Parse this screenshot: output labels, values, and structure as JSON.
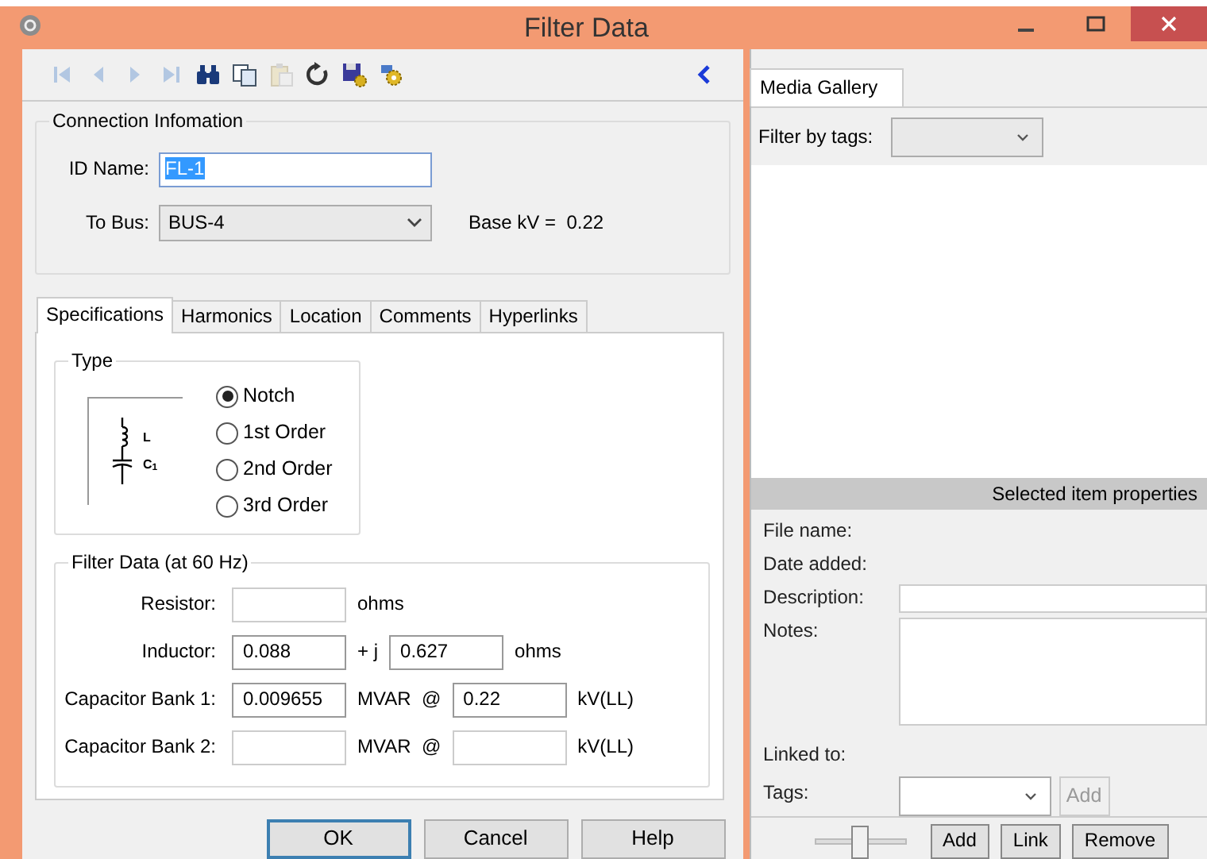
{
  "window": {
    "title": "Filter Data"
  },
  "toolbar": [
    {
      "kind": "first",
      "disabled": true
    },
    {
      "kind": "previous",
      "disabled": true
    },
    {
      "kind": "next",
      "disabled": true
    },
    {
      "kind": "last",
      "disabled": true
    },
    {
      "kind": "find",
      "disabled": false
    },
    {
      "kind": "copy",
      "disabled": false
    },
    {
      "kind": "paste",
      "disabled": true
    },
    {
      "kind": "undo",
      "disabled": false
    },
    {
      "kind": "save",
      "disabled": false
    },
    {
      "kind": "settings",
      "disabled": false
    }
  ],
  "connection": {
    "title": "Connection Infomation",
    "id_label": "ID Name:",
    "id_value": "FL-1",
    "bus_label": "To Bus:",
    "bus_value": "BUS-4",
    "base_kv": "Base kV =  0.22"
  },
  "tabs": [
    {
      "label": "Specifications",
      "selected": true
    },
    {
      "label": "Harmonics",
      "selected": false
    },
    {
      "label": "Location",
      "selected": false
    },
    {
      "label": "Comments",
      "selected": false
    },
    {
      "label": "Hyperlinks",
      "selected": false
    }
  ],
  "type_group": {
    "title": "Type",
    "diagram_labels": [
      "L",
      "C$_{1}$"
    ],
    "options": [
      {
        "label": "Notch",
        "selected": true
      },
      {
        "label": "1st Order",
        "selected": false
      },
      {
        "label": "2nd Order",
        "selected": false
      },
      {
        "label": "3rd Order",
        "selected": false
      }
    ]
  },
  "filter_data": {
    "title": "Filter Data (at 60 Hz)",
    "rows": [
      {
        "kind": "single",
        "label": "Resistor:",
        "unit": "ohms"
      },
      {
        "kind": "double",
        "label": "Inductor:",
        "value": "0.088",
        "separator": "+ j",
        "value_2": "0.627",
        "unit": "ohms"
      },
      {
        "kind": "double",
        "label": "Capacitor Bank 1:",
        "value": "0.009655",
        "separator": "MVAR  @",
        "value_2": "0.22",
        "unit": "kV(LL)"
      },
      {
        "kind": "double",
        "label": "Capacitor Bank 2:",
        "separator": "MVAR  @",
        "unit": "kV(LL)"
      }
    ]
  },
  "buttons": [
    {
      "label": "OK",
      "default": true
    },
    {
      "label": "Cancel",
      "default": false
    },
    {
      "label": "Help",
      "default": false
    }
  ],
  "gallery": {
    "tab": {
      "label": "Media Gallery",
      "selected": true
    },
    "filter_label": "Filter by tags:",
    "properties_title": "Selected item properties",
    "properties": [
      {
        "kind": "text",
        "label": "File name:"
      },
      {
        "kind": "text",
        "label": "Date added:"
      },
      {
        "kind": "field",
        "label": "Description:"
      },
      {
        "kind": "notes",
        "label": "Notes:"
      },
      {
        "kind": "text",
        "label": "Linked to:"
      },
      {
        "kind": "tags",
        "label": "Tags:",
        "button": "Add",
        "disabled": true
      }
    ],
    "zoom_slider": {
      "level": 0.5
    },
    "buttons": [
      "Add",
      "Link",
      "Remove"
    ]
  }
}
